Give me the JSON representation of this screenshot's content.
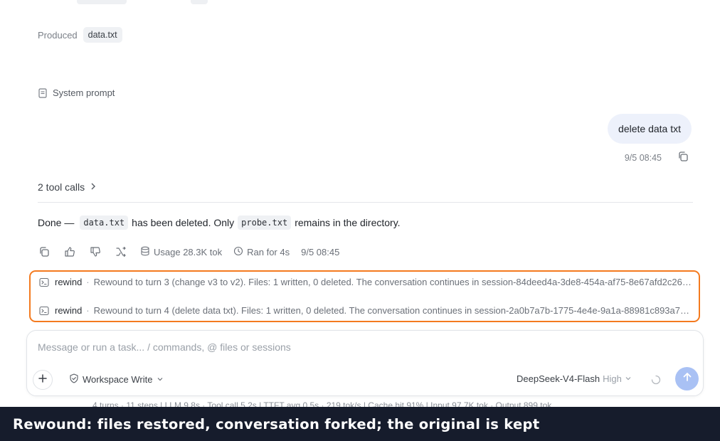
{
  "produced": {
    "label": "Produced",
    "file": "data.txt"
  },
  "system_prompt": {
    "label": "System prompt"
  },
  "user_message": {
    "text": "delete data txt",
    "timestamp": "9/5 08:45"
  },
  "tool_calls": {
    "label": "2 tool calls"
  },
  "assistant": {
    "before": "Done —",
    "file1": "data.txt",
    "middle": "has been deleted. Only",
    "file2": "probe.txt",
    "after": "remains in the directory.",
    "usage": "Usage 28.3K tok",
    "duration": "Ran for 4s",
    "timestamp": "9/5 08:45"
  },
  "rewinds": [
    {
      "command": "rewind",
      "separator": "·",
      "message": "Rewound to turn 3 (change v3 to v2). Files: 1 written, 0 deleted. The conversation continues in session-84deed4a-3de8-454a-af75-8e67afd2c26…"
    },
    {
      "command": "rewind",
      "separator": "·",
      "message": "Rewound to turn 4 (delete data txt). Files: 1 written, 0 deleted. The conversation continues in session-2a0b7a7b-1775-4e4e-9a1a-88981c893a7…"
    }
  ],
  "stats_line": "4 turns · 11 steps   |   LLM 9.8s · Tool call 5.2s   |   TTFT avg 0.5s · 219 tok/s   |   Cache hit 91%   |   Input 97.7K tok · Output 899 tok",
  "composer": {
    "placeholder": "Message or run a task... / commands, @ files or sessions",
    "value": "",
    "mode": "Workspace Write",
    "model": "DeepSeek-V4-Flash",
    "effort": "High"
  },
  "caption": "Rewound: files restored, conversation forked; the original is kept",
  "colors": {
    "highlight": "#f47a1f",
    "send": "#a9c1f4",
    "caption_bg": "#161c2c"
  }
}
